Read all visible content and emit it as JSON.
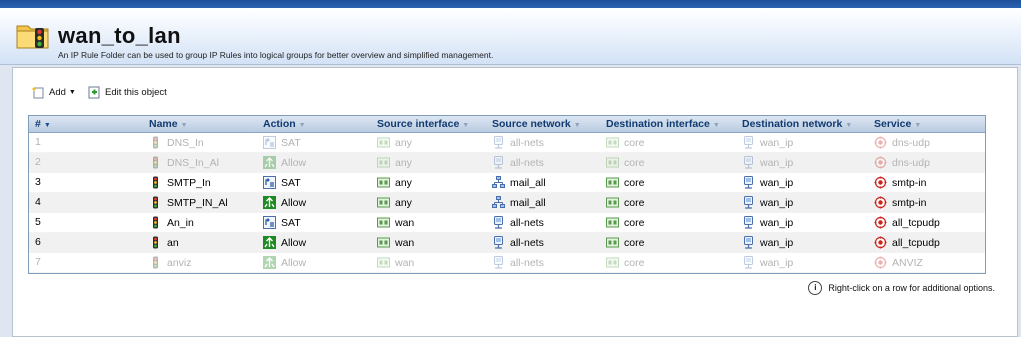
{
  "page": {
    "title": "wan_to_lan",
    "subtitle": "An IP Rule Folder can be used to group IP Rules into logical groups for better overview and simplified management."
  },
  "toolbar": {
    "add_label": "Add",
    "edit_label": "Edit this object"
  },
  "table": {
    "columns": {
      "num": "#",
      "name": "Name",
      "action": "Action",
      "src_if": "Source interface",
      "src_net": "Source network",
      "dst_if": "Destination interface",
      "dst_net": "Destination network",
      "service": "Service"
    },
    "rows": [
      {
        "num": "1",
        "name": "DNS_In",
        "action": "SAT",
        "src_if": "any",
        "src_net": "all-nets",
        "dst_if": "core",
        "dst_net": "wan_ip",
        "service": "dns-udp",
        "disabled": true
      },
      {
        "num": "2",
        "name": "DNS_In_Al",
        "action": "Allow",
        "src_if": "any",
        "src_net": "all-nets",
        "dst_if": "core",
        "dst_net": "wan_ip",
        "service": "dns-udp",
        "disabled": true
      },
      {
        "num": "3",
        "name": "SMTP_In",
        "action": "SAT",
        "src_if": "any",
        "src_net": "mail_all",
        "dst_if": "core",
        "dst_net": "wan_ip",
        "service": "smtp-in",
        "disabled": false
      },
      {
        "num": "4",
        "name": "SMTP_IN_Al",
        "action": "Allow",
        "src_if": "any",
        "src_net": "mail_all",
        "dst_if": "core",
        "dst_net": "wan_ip",
        "service": "smtp-in",
        "disabled": false
      },
      {
        "num": "5",
        "name": "An_in",
        "action": "SAT",
        "src_if": "wan",
        "src_net": "all-nets",
        "dst_if": "core",
        "dst_net": "wan_ip",
        "service": "all_tcpudp",
        "disabled": false
      },
      {
        "num": "6",
        "name": "an",
        "action": "Allow",
        "src_if": "wan",
        "src_net": "all-nets",
        "dst_if": "core",
        "dst_net": "wan_ip",
        "service": "all_tcpudp",
        "disabled": false
      },
      {
        "num": "7",
        "name": "anviz",
        "action": "Allow",
        "src_if": "wan",
        "src_net": "all-nets",
        "dst_if": "core",
        "dst_net": "wan_ip",
        "service": "ANVIZ",
        "disabled": true
      }
    ]
  },
  "hint": "Right-click on a row for additional options.",
  "colors": {
    "header_text": "#113a70",
    "disabled_text": "#b3b3b3",
    "allow_green": "#1f8a24",
    "service_red": "#c8261c"
  }
}
